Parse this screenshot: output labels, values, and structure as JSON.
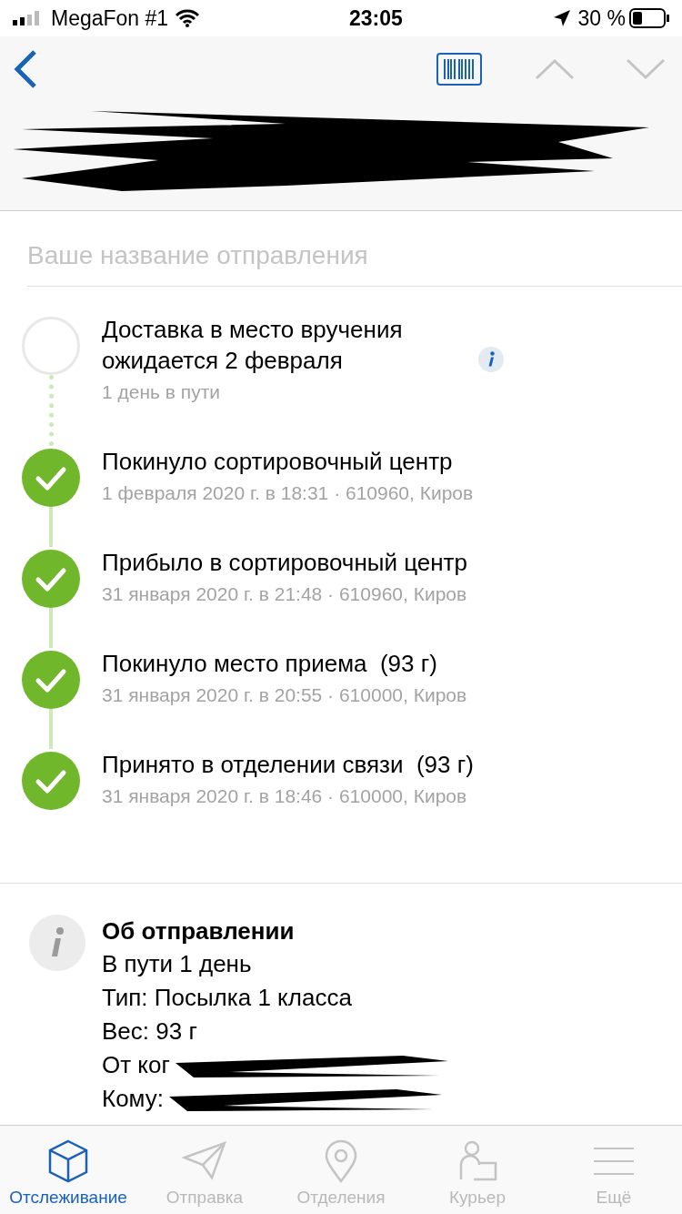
{
  "status_bar": {
    "carrier": "MegaFon #1",
    "time": "23:05",
    "battery": "30 %"
  },
  "header": {
    "redacted": true
  },
  "name_field": {
    "placeholder": "Ваше название отправления"
  },
  "events": [
    {
      "kind": "expected",
      "done": false,
      "title": "Доставка в место вручения ожидается 2 февраля",
      "detail": "1 день в пути"
    },
    {
      "kind": "step",
      "done": true,
      "title": "Покинуло сортировочный центр",
      "detail": "1 февраля 2020 г. в 18:31 · 610960, Киров"
    },
    {
      "kind": "step",
      "done": true,
      "title": "Прибыло в сортировочный центр",
      "detail": "31 января 2020 г. в 21:48 · 610960, Киров"
    },
    {
      "kind": "step",
      "done": true,
      "title": "Покинуло место приема",
      "weight": "(93 г)",
      "detail": "31 января 2020 г. в 20:55 · 610000, Киров"
    },
    {
      "kind": "step",
      "done": true,
      "title": "Принято в отделении связи",
      "weight": "(93 г)",
      "detail": "31 января 2020 г. в 18:46 · 610000, Киров"
    }
  ],
  "about": {
    "title": "Об отправлении",
    "lines": [
      {
        "text": "В пути 1 день",
        "redacted": false
      },
      {
        "text": "Тип: Посылка 1 класса",
        "redacted": false
      },
      {
        "text": "Вес: 93 г",
        "redacted": false
      },
      {
        "text": "От ког",
        "redacted": true
      },
      {
        "text": "Кому:",
        "redacted": true
      }
    ]
  },
  "tabs": [
    {
      "label": "Отслеживание",
      "selected": true
    },
    {
      "label": "Отправка",
      "selected": false
    },
    {
      "label": "Отделения",
      "selected": false
    },
    {
      "label": "Курьер",
      "selected": false
    },
    {
      "label": "Ещё",
      "selected": false
    }
  ]
}
